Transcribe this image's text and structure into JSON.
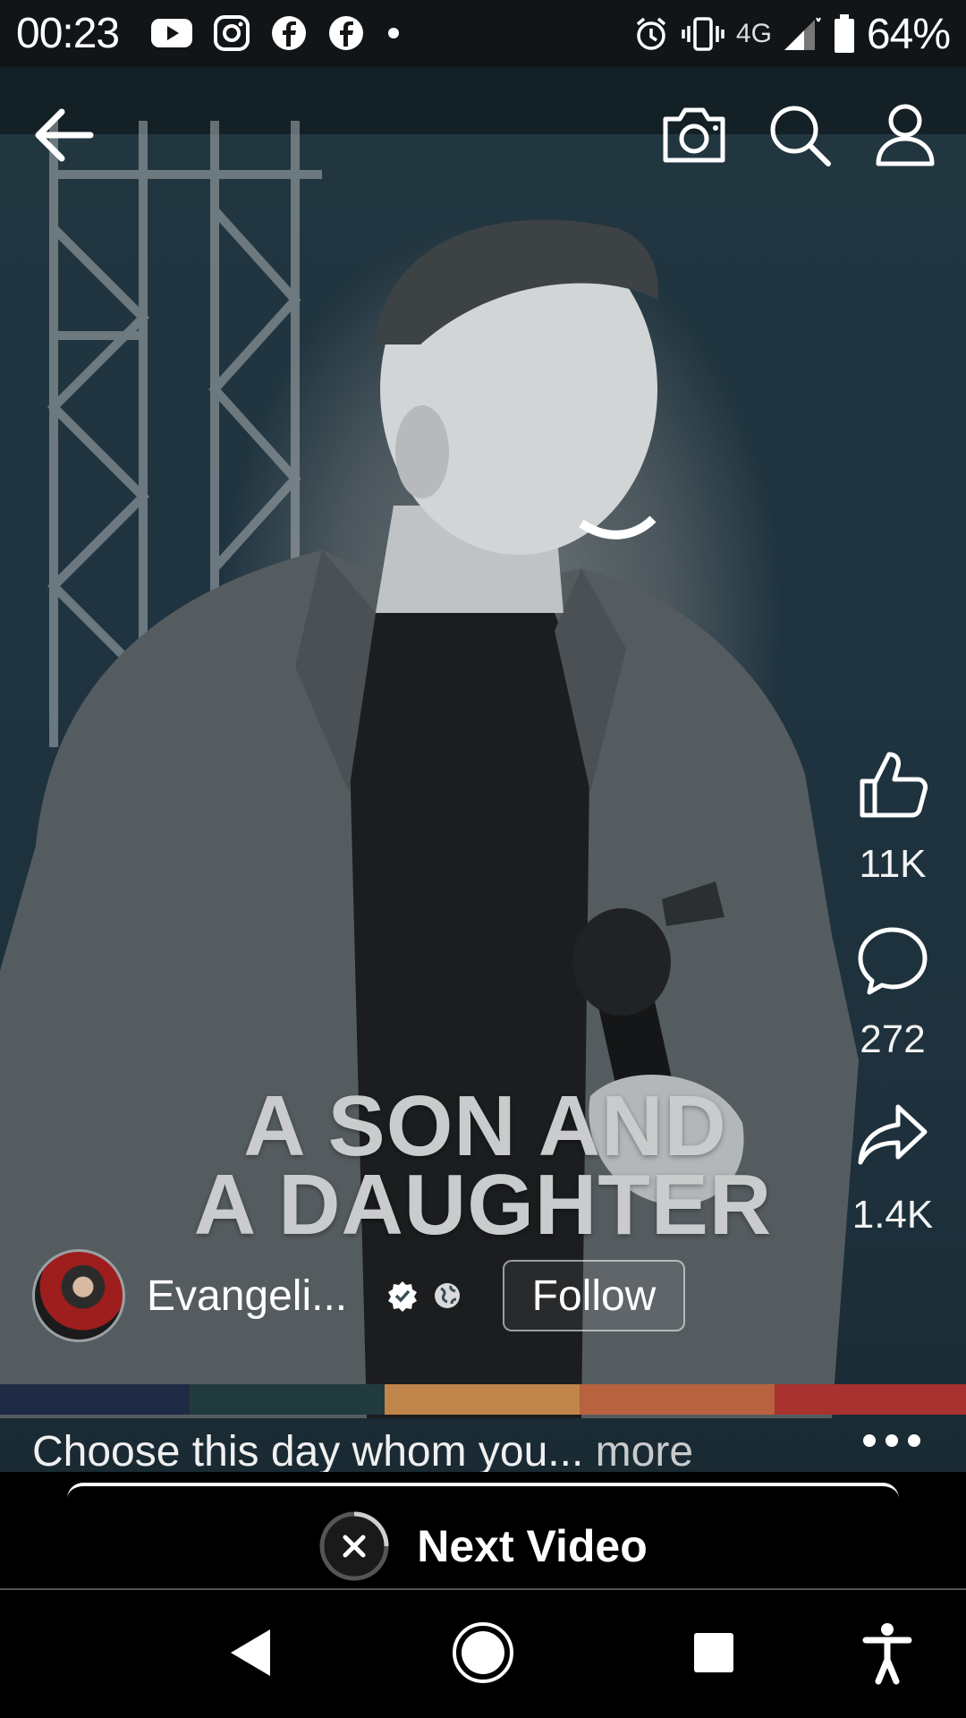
{
  "status_bar": {
    "time": "00:23",
    "network": "4G",
    "battery": "64%",
    "left_icons": [
      "youtube-icon",
      "instagram-icon",
      "facebook-icon",
      "facebook-icon",
      "dot-icon"
    ],
    "right_icons": [
      "alarm-icon",
      "vibrate-icon",
      "signal-icon",
      "battery-icon"
    ]
  },
  "top_nav": {
    "icons": [
      "back-arrow-icon",
      "camera-icon",
      "search-icon",
      "profile-icon"
    ]
  },
  "video": {
    "title_line_1": "A SON AND",
    "title_line_2": "A DAUGHTER"
  },
  "actions": {
    "like_count": "11K",
    "comment_count": "272",
    "share_count": "1.4K"
  },
  "author": {
    "name": "Evangeli...",
    "follow_label": "Follow"
  },
  "caption": {
    "text": "Choose this day whom you...",
    "more_label": "more"
  },
  "next_video": {
    "label": "Next Video"
  },
  "colors": {
    "strip": [
      "#1f2a44",
      "#213a3e",
      "#c0854a",
      "#b8623f",
      "#a8322f"
    ],
    "video_bg": "#1f3440"
  }
}
